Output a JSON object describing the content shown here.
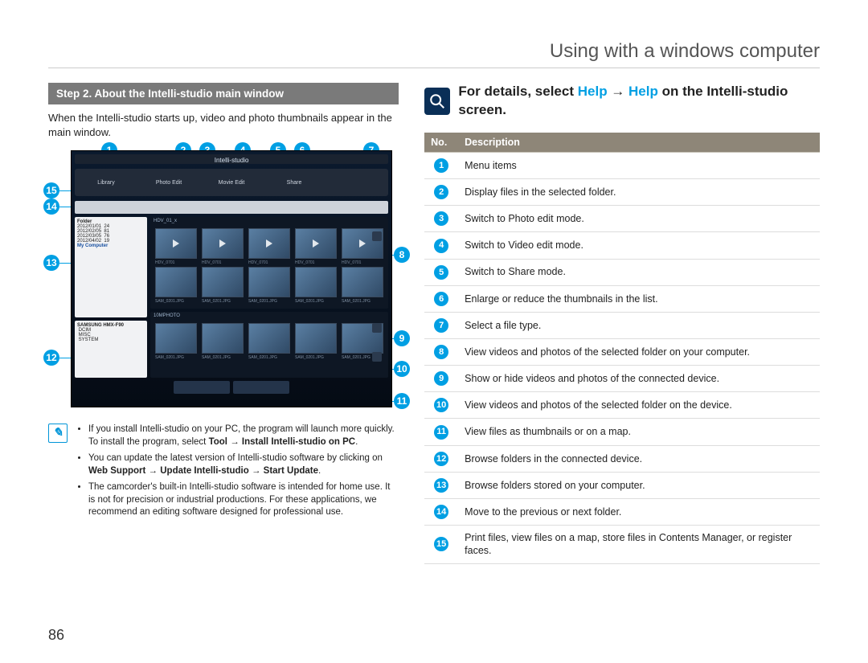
{
  "page": {
    "title": "Using with a windows computer",
    "number": "86"
  },
  "left": {
    "step_bar": "Step 2. About the Intelli-studio main window",
    "intro": "When the Intelli-studio starts up, video and photo thumbnails appear in the main window.",
    "callouts_top": [
      "1",
      "2",
      "3",
      "4",
      "5",
      "6",
      "7"
    ],
    "callouts_right": [
      "8",
      "9",
      "10",
      "11"
    ],
    "callouts_left": [
      "15",
      "14",
      "13",
      "12"
    ],
    "shot": {
      "top_labels": [
        "Library",
        "Photo Edit",
        "Movie Edit",
        "Share"
      ],
      "brand": "Intelli-studio",
      "folder_sample": [
        "2012/01/01",
        "2012/02/05",
        "2012/03/05",
        "2012/04/02"
      ],
      "section_top": "HDV_01_x",
      "section_bot": "10MPHOTO",
      "thumb_cap_a": "HDV_0701",
      "thumb_cap_b": "SAM_0201.JPG"
    },
    "notes": [
      {
        "pre": "If you install Intelli-studio on your PC, the program will launch more quickly. To install the program, select ",
        "b1": "Tool",
        "arrow1": " → ",
        "b2": "Install Intelli-studio on PC",
        "post": "."
      },
      {
        "pre": "You can update the latest version of Intelli-studio software by clicking on ",
        "b1": "Web Support ",
        "arrow1": " → ",
        "b2": "Update Intelli-studio",
        "arrow2": " → ",
        "b3": "Start Update",
        "post": "."
      },
      {
        "pre": "The camcorder's built-in Intelli-studio software is intended for home use. It is not for precision or industrial productions. For these applications, we recommend an editing software designed for professional use.",
        "b1": "",
        "arrow1": "",
        "b2": "",
        "arrow2": "",
        "b3": "",
        "post": ""
      }
    ]
  },
  "right": {
    "help_pre": "For details, select ",
    "help_h1": "Help",
    "help_arrow": " → ",
    "help_h2": "Help",
    "help_post": " on the Intelli-studio screen.",
    "table_headers": {
      "no": "No.",
      "desc": "Description"
    },
    "rows": [
      {
        "n": "1",
        "d": "Menu items"
      },
      {
        "n": "2",
        "d": "Display files in the selected folder."
      },
      {
        "n": "3",
        "d": "Switch to Photo edit mode."
      },
      {
        "n": "4",
        "d": "Switch to Video edit mode."
      },
      {
        "n": "5",
        "d": "Switch to Share mode."
      },
      {
        "n": "6",
        "d": "Enlarge or reduce the thumbnails in the list."
      },
      {
        "n": "7",
        "d": "Select a file type."
      },
      {
        "n": "8",
        "d": "View videos and photos of the selected folder on your computer."
      },
      {
        "n": "9",
        "d": "Show or hide videos and photos of the connected device."
      },
      {
        "n": "10",
        "d": "View videos and photos of the selected folder on the device."
      },
      {
        "n": "11",
        "d": "View files as thumbnails or on a map."
      },
      {
        "n": "12",
        "d": "Browse folders in the connected device."
      },
      {
        "n": "13",
        "d": "Browse folders stored on your computer."
      },
      {
        "n": "14",
        "d": "Move to the previous or next folder."
      },
      {
        "n": "15",
        "d": "Print files, view files on a map, store files in Contents Manager, or register faces."
      }
    ]
  }
}
